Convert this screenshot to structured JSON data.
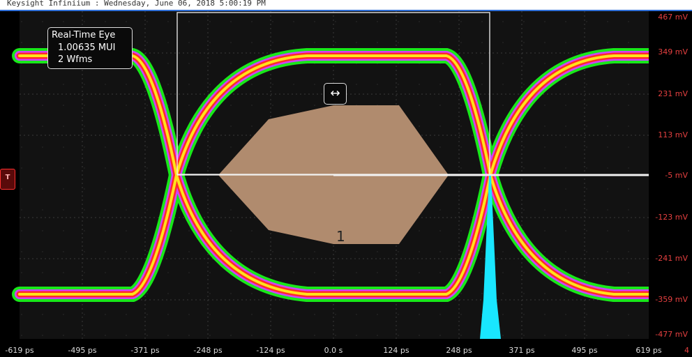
{
  "window": {
    "title": "Keysight Infiniium : Wednesday, June 06, 2018 5:00:19 PM"
  },
  "eye_panel": {
    "title": "Real-Time Eye",
    "mui": "1.00635 MUI",
    "wfms": "2 Wfms"
  },
  "marker_button": {
    "icon": "↔",
    "icon_name": "horizontal-arrows-icon"
  },
  "trigger": {
    "label": "T",
    "icon_name": "trigger-icon",
    "color": "#ff3030"
  },
  "mask": {
    "number": "1",
    "color": "#b08b6e"
  },
  "axes": {
    "y_ticks": [
      "467 mV",
      "349 mV",
      "231 mV",
      "113 mV",
      "-5 mV",
      "-123 mV",
      "-241 mV",
      "-359 mV",
      "-477 mV"
    ],
    "x_ticks": [
      "-619 ps",
      "-495 ps",
      "-371 ps",
      "-248 ps",
      "-124 ps",
      "0.0 s",
      "124 ps",
      "248 ps",
      "371 ps",
      "495 ps",
      "619 ps"
    ],
    "corner_label": "4"
  },
  "colors": {
    "y_axis_text": "#e64040",
    "x_axis_text": "#dcdcdc",
    "histogram": "#19e6ff",
    "title_accent": "#2f6fd8"
  }
}
